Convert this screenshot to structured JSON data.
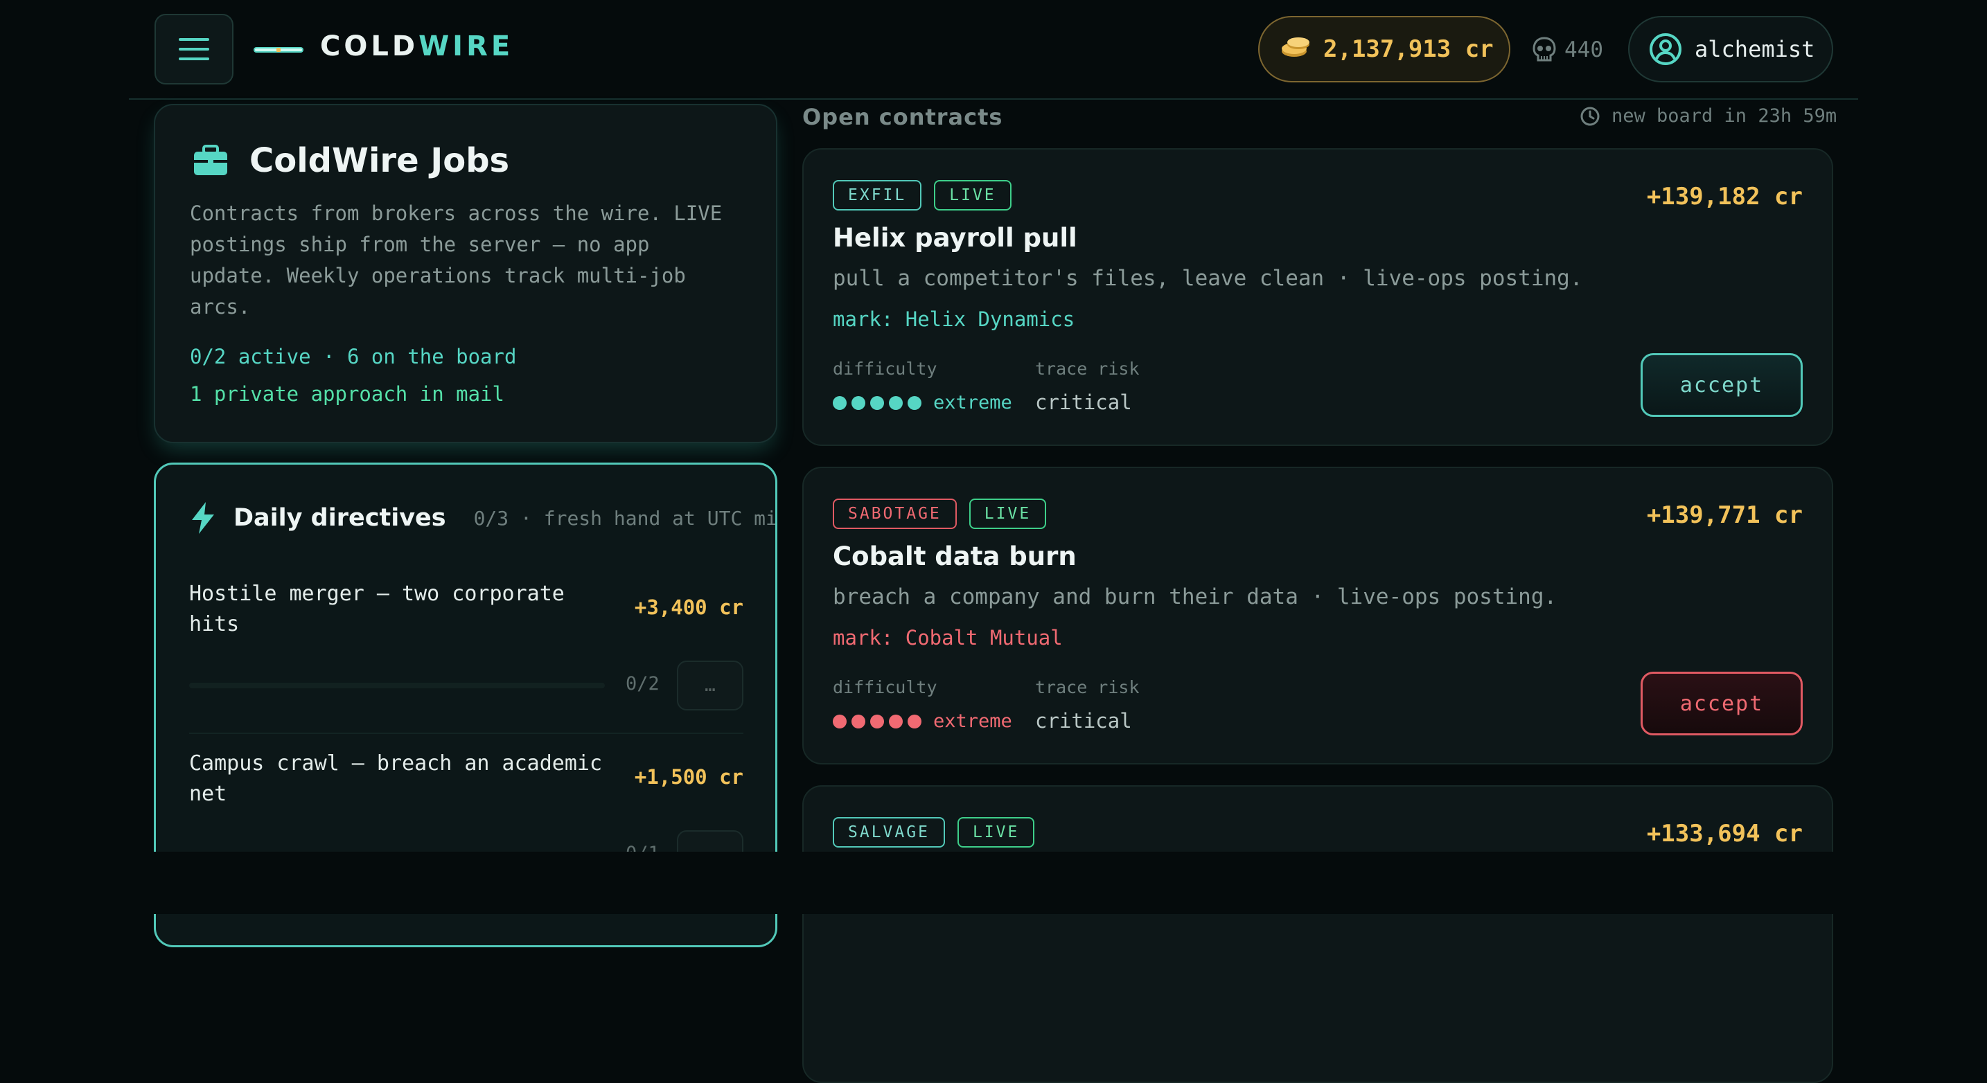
{
  "app": {
    "logo_left": "COLD",
    "logo_right": "WIRE",
    "credits": "2,137,913 cr",
    "kills": "440",
    "username": "alchemist"
  },
  "jobs": {
    "title": "ColdWire Jobs",
    "description": "Contracts from brokers across the wire. LIVE postings ship from the server — no app update. Weekly operations track multi-job arcs.",
    "active": "0/2 active · 6 on the board",
    "approach": "1 private approach in mail"
  },
  "daily": {
    "title": "Daily directives",
    "meta": "0/3 · fresh hand at UTC mi",
    "items": [
      {
        "title": "Hostile merger — two corporate hits",
        "reward": "+3,400 cr",
        "progress": "0/2",
        "progress_fraction": 0,
        "action": "…"
      },
      {
        "title": "Campus crawl — breach an academic net",
        "reward": "+1,500 cr",
        "progress": "0/1",
        "progress_fraction": 0,
        "action": "…"
      }
    ]
  },
  "contracts": {
    "heading": "Open contracts",
    "timer": "new board in 23h 59m",
    "difficulty_label": "difficulty",
    "risk_label": "trace risk",
    "items": [
      {
        "tag": "EXFIL",
        "live": "LIVE",
        "payout": "+139,182 cr",
        "title": "Helix payroll pull",
        "subtitle": "pull a competitor's files, leave clean · live-ops posting.",
        "mark": "mark: Helix Dynamics",
        "level": "extreme",
        "dots": 5,
        "risk": "critical",
        "accept": "accept",
        "color": "#56d6c4"
      },
      {
        "tag": "SABOTAGE",
        "live": "LIVE",
        "payout": "+139,771 cr",
        "title": "Cobalt data burn",
        "subtitle": "breach a company and burn their data · live-ops posting.",
        "mark": "mark: Cobalt Mutual",
        "level": "extreme",
        "dots": 5,
        "risk": "critical",
        "accept": "accept",
        "color": "#f06a72"
      },
      {
        "tag": "SALVAGE",
        "live": "LIVE",
        "payout": "+133,694 cr"
      }
    ]
  },
  "icons": {
    "menu": "hamburger-icon",
    "coins": "coins-icon",
    "skull": "skull-icon",
    "user": "user-circle-icon",
    "briefcase": "briefcase-icon",
    "bolt": "lightning-icon",
    "clock": "clock-icon"
  }
}
